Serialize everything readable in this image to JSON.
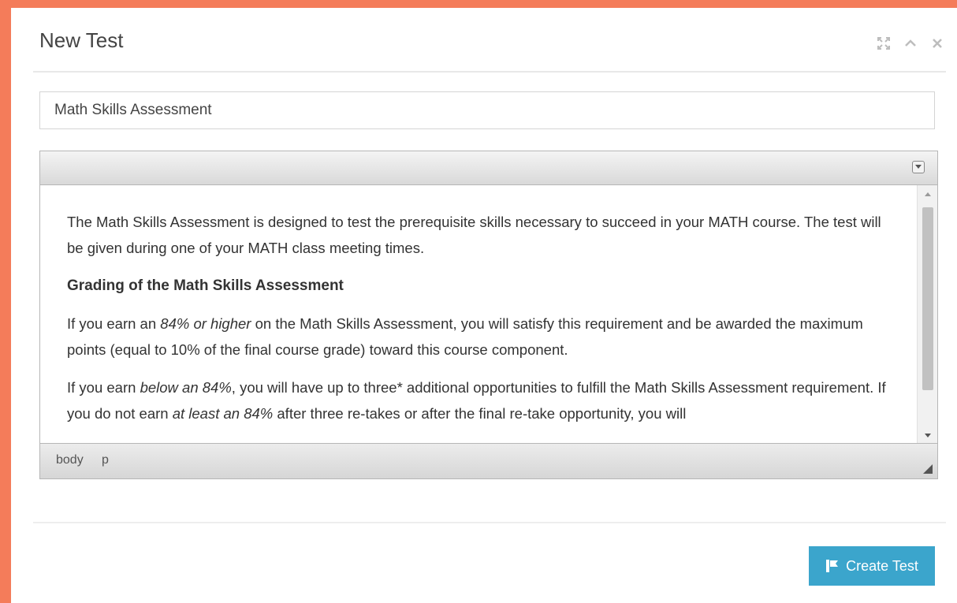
{
  "dialog": {
    "title": "New Test",
    "icons": [
      "expand-icon",
      "collapse-icon",
      "close-icon"
    ]
  },
  "test_name_input": {
    "value": "Math Skills Assessment"
  },
  "editor": {
    "intro": "The Math Skills Assessment is designed to test the prerequisite skills necessary to succeed in your MATH course. The test will be given during one of your MATH class meeting times.",
    "heading": "Grading of the Math Skills Assessment",
    "p2_a": "If you earn an ",
    "p2_em": "84% or higher",
    "p2_b": " on the Math Skills Assessment, you will satisfy this requirement and be awarded the maximum points (equal to 10% of the final course grade) toward this course component.",
    "p3_a": "If you earn ",
    "p3_em": "below an 84%",
    "p3_b": ", you will have up to three* additional opportunities to fulfill the Math Skills Assessment requirement. If you do not earn ",
    "p3_em2": "at least an 84%",
    "p3_c": " after three re-takes or after the final re-take opportunity, you will",
    "path": [
      "body",
      "p"
    ]
  },
  "footer": {
    "create_label": "Create Test"
  },
  "colors": {
    "frame": "#f47c5a",
    "button": "#3ba5cc"
  }
}
